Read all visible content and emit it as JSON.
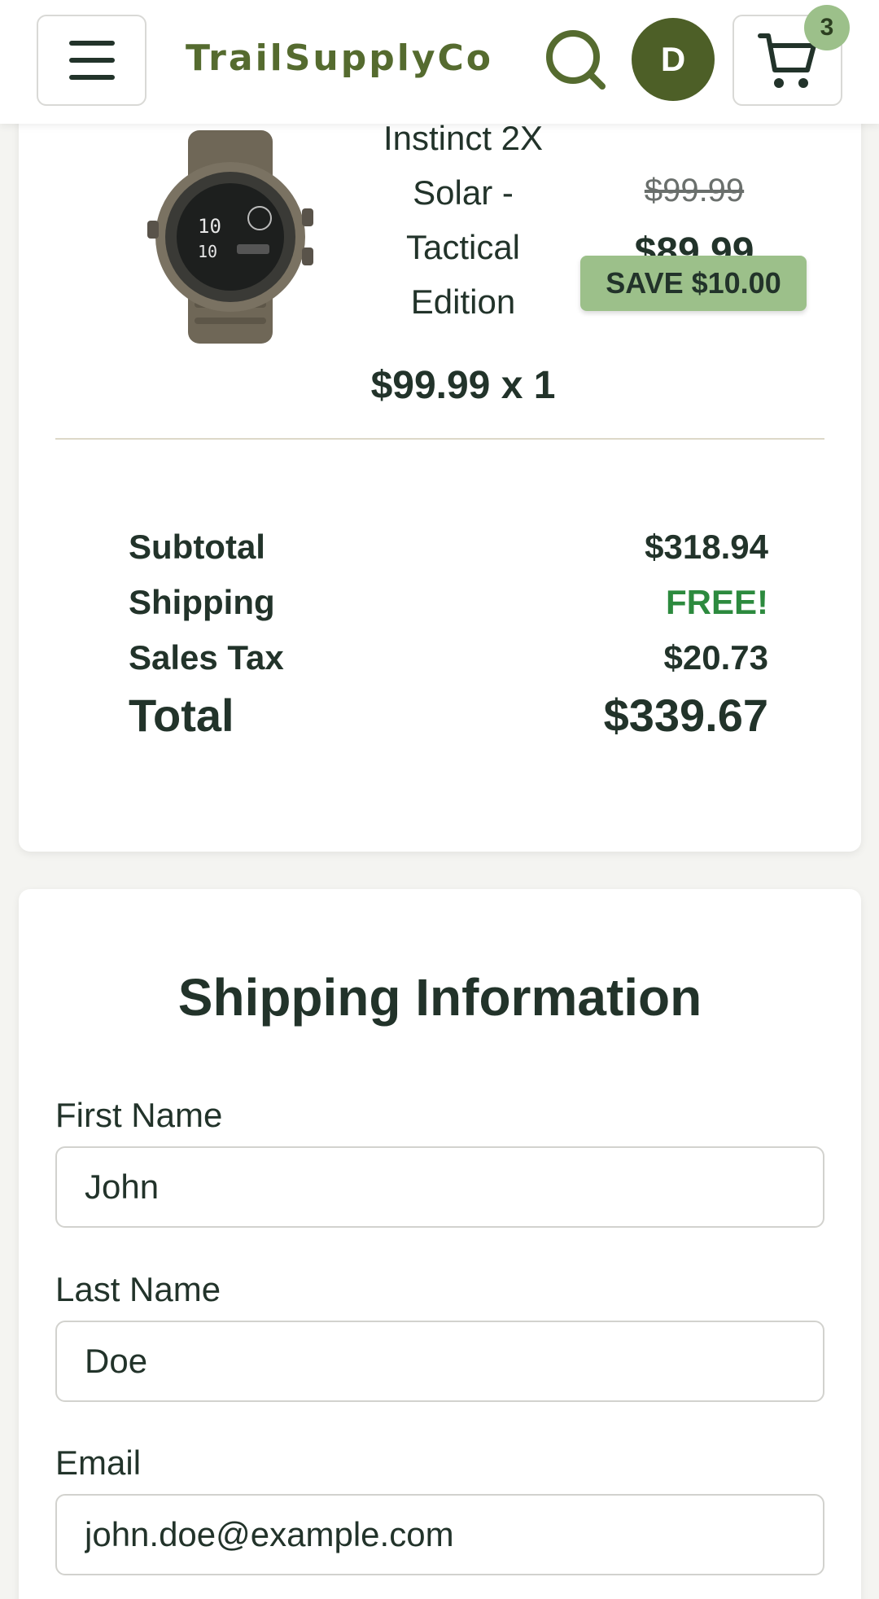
{
  "header": {
    "logo": "TrailSupplyCo",
    "avatar_initial": "D",
    "cart_count": "3"
  },
  "cart_item": {
    "name_lines": [
      "Instinct 2X",
      "Solar -",
      "Tactical",
      "Edition"
    ],
    "unit_line": "$99.99 x 1",
    "original_price": "$99.99",
    "sale_price": "$89.99",
    "savings": "SAVE $10.00"
  },
  "summary": {
    "subtotal_label": "Subtotal",
    "subtotal_value": "$318.94",
    "shipping_label": "Shipping",
    "shipping_value": "FREE!",
    "tax_label": "Sales Tax",
    "tax_value": "$20.73",
    "total_label": "Total",
    "total_value": "$339.67"
  },
  "shipping_form": {
    "title": "Shipping Information",
    "first_name_label": "First Name",
    "first_name_value": "John",
    "last_name_label": "Last Name",
    "last_name_value": "Doe",
    "email_label": "Email",
    "email_value": "john.doe@example.com"
  },
  "colors": {
    "brand": "#556b2f",
    "avatar_bg": "#4d5f27",
    "badge_bg": "#9cc08a",
    "free_text": "#2c8a3e"
  }
}
